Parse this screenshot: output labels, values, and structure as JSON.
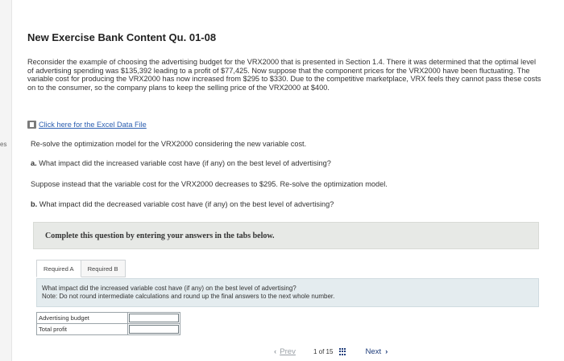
{
  "side_text": "es",
  "title": "New Exercise Bank Content Qu. 01-08",
  "paragraph": "Reconsider the example of choosing the advertising budget for the VRX2000 that is presented in Section 1.4. There it was determined that the optimal level of advertising spending was $135,392 leading to a profit of $77,425. Now suppose that the component prices for the VRX2000 have been fluctuating. The variable cost for producing the VRX2000 has now increased from $295 to $330. Due to the competitive marketplace, VRX feels they cannot pass these costs on to the consumer, so the company plans to keep the selling price of the VRX2000 at $400.",
  "excel_link": "Click here for the Excel Data File",
  "resolve_1": "Re-solve the optimization model for the VRX2000 considering the new variable cost.",
  "question_a_prefix": "a.",
  "question_a": "What impact did the increased variable cost have (if any) on the best level of advertising?",
  "resolve_2": "Suppose instead that the variable cost for the VRX2000 decreases to $295. Re-solve the optimization model.",
  "question_b_prefix": "b.",
  "question_b": "What impact did the decreased variable cost have (if any) on the best level of advertising?",
  "banner": "Complete this question by entering your answers in the tabs below.",
  "tabs": [
    "Required A",
    "Required B"
  ],
  "prompt_line_1": "What impact did the increased variable cost have (if any) on the best level of advertising?",
  "prompt_line_2": "Note: Do not round intermediate calculations and round up the final answers to the next whole number.",
  "rows": [
    "Advertising budget",
    "Total profit"
  ],
  "nav": {
    "prev": "Prev",
    "page": "1",
    "of": "of",
    "total": "15",
    "next": "Next"
  },
  "icons": {
    "prev": "chevron-left-icon",
    "next": "chevron-right-icon",
    "grid": "grid-icon",
    "excel": "excel-file-icon"
  }
}
